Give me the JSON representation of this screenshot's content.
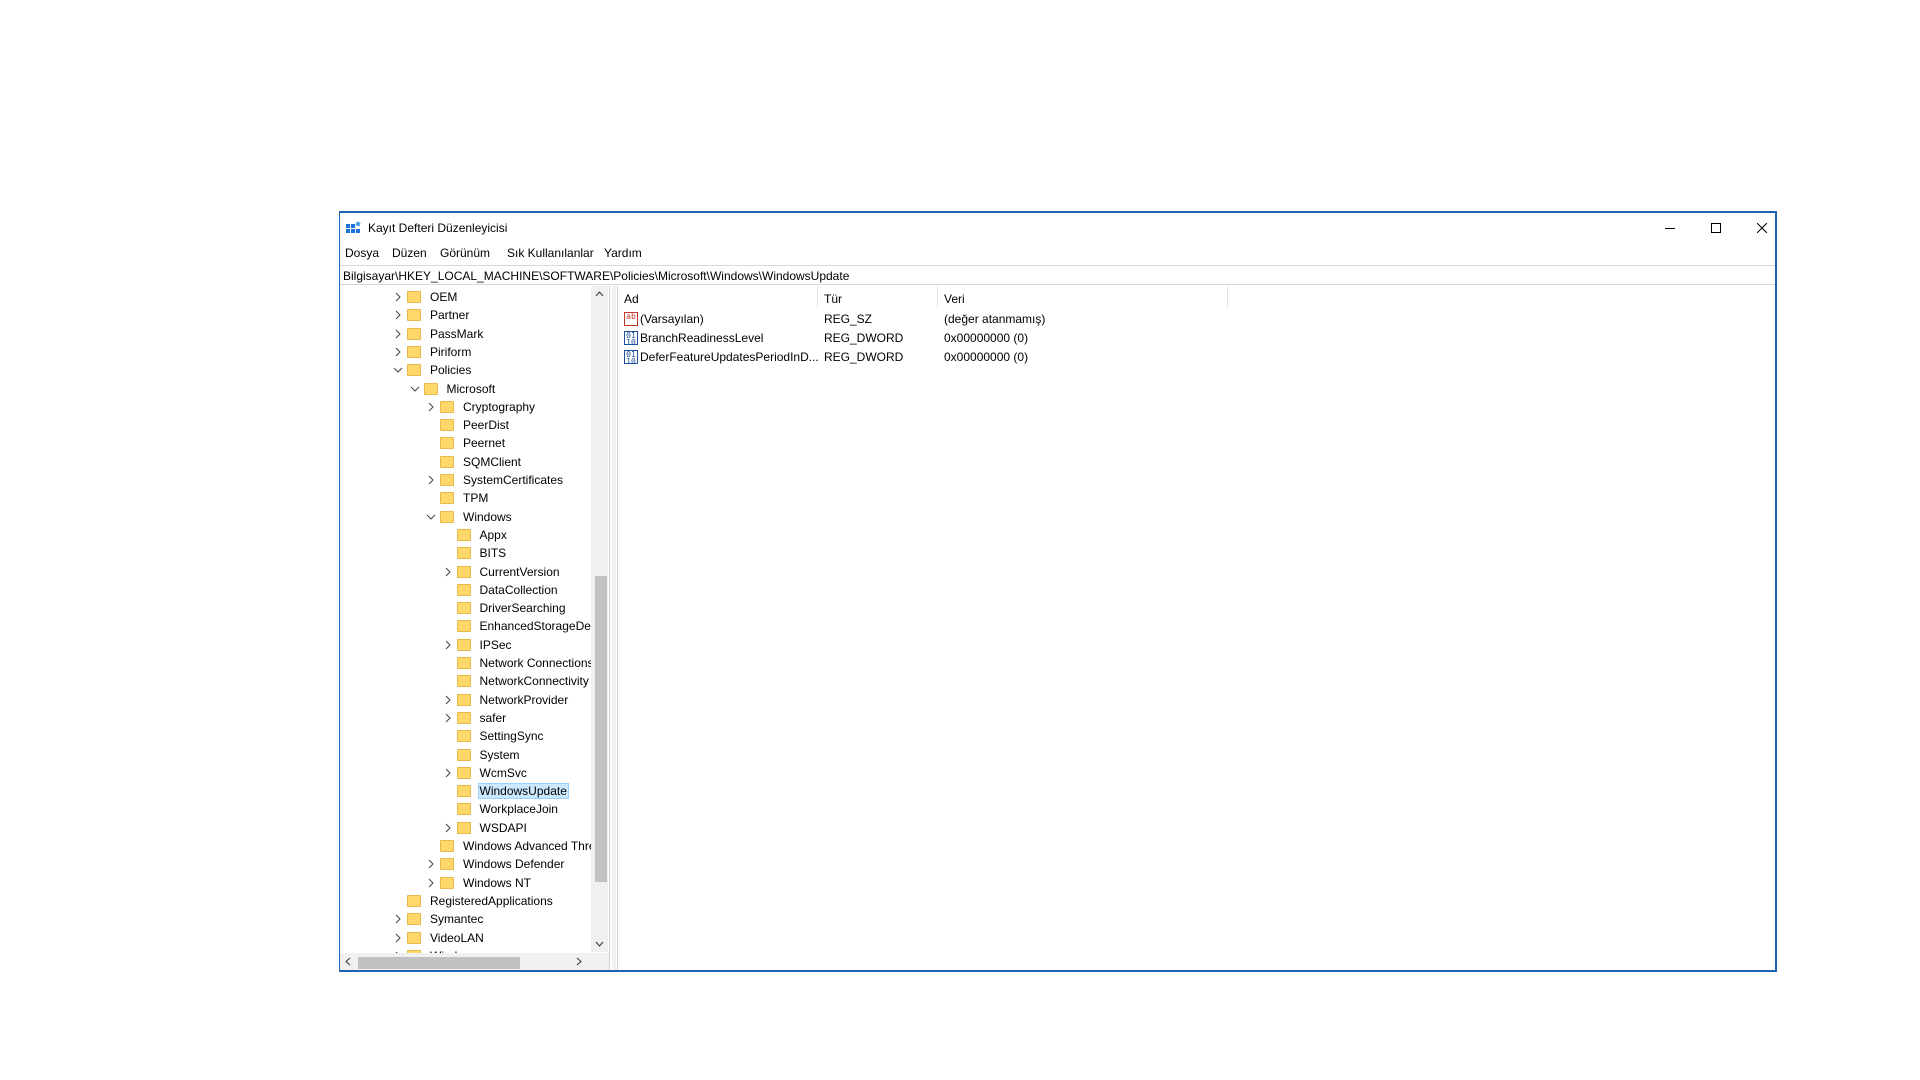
{
  "window": {
    "title": "Kayıt Defteri Düzenleyicisi",
    "controls": [
      "minimize",
      "maximize",
      "close"
    ]
  },
  "menu": [
    "Dosya",
    "Düzen",
    "Görünüm",
    "Sık Kullanılanlar",
    "Yardım"
  ],
  "address": "Bilgisayar\\HKEY_LOCAL_MACHINE\\SOFTWARE\\Policies\\Microsoft\\Windows\\WindowsUpdate",
  "tree": [
    {
      "label": "OEM",
      "depth": 0,
      "expander": "collapsed"
    },
    {
      "label": "Partner",
      "depth": 0,
      "expander": "collapsed"
    },
    {
      "label": "PassMark",
      "depth": 0,
      "expander": "collapsed"
    },
    {
      "label": "Piriform",
      "depth": 0,
      "expander": "collapsed"
    },
    {
      "label": "Policies",
      "depth": 0,
      "expander": "expanded"
    },
    {
      "label": "Microsoft",
      "depth": 1,
      "expander": "expanded"
    },
    {
      "label": "Cryptography",
      "depth": 2,
      "expander": "collapsed"
    },
    {
      "label": "PeerDist",
      "depth": 2,
      "expander": "none"
    },
    {
      "label": "Peernet",
      "depth": 2,
      "expander": "none"
    },
    {
      "label": "SQMClient",
      "depth": 2,
      "expander": "none"
    },
    {
      "label": "SystemCertificates",
      "depth": 2,
      "expander": "collapsed"
    },
    {
      "label": "TPM",
      "depth": 2,
      "expander": "none"
    },
    {
      "label": "Windows",
      "depth": 2,
      "expander": "expanded"
    },
    {
      "label": "Appx",
      "depth": 3,
      "expander": "none"
    },
    {
      "label": "BITS",
      "depth": 3,
      "expander": "none"
    },
    {
      "label": "CurrentVersion",
      "depth": 3,
      "expander": "collapsed"
    },
    {
      "label": "DataCollection",
      "depth": 3,
      "expander": "none"
    },
    {
      "label": "DriverSearching",
      "depth": 3,
      "expander": "none"
    },
    {
      "label": "EnhancedStorageDev",
      "depth": 3,
      "expander": "none"
    },
    {
      "label": "IPSec",
      "depth": 3,
      "expander": "collapsed"
    },
    {
      "label": "Network Connections",
      "depth": 3,
      "expander": "none"
    },
    {
      "label": "NetworkConnectivity",
      "depth": 3,
      "expander": "none"
    },
    {
      "label": "NetworkProvider",
      "depth": 3,
      "expander": "collapsed"
    },
    {
      "label": "safer",
      "depth": 3,
      "expander": "collapsed"
    },
    {
      "label": "SettingSync",
      "depth": 3,
      "expander": "none"
    },
    {
      "label": "System",
      "depth": 3,
      "expander": "none"
    },
    {
      "label": "WcmSvc",
      "depth": 3,
      "expander": "collapsed"
    },
    {
      "label": "WindowsUpdate",
      "depth": 3,
      "expander": "none",
      "selected": true
    },
    {
      "label": "WorkplaceJoin",
      "depth": 3,
      "expander": "none"
    },
    {
      "label": "WSDAPI",
      "depth": 3,
      "expander": "collapsed"
    },
    {
      "label": "Windows Advanced Threat",
      "depth": 2,
      "expander": "none"
    },
    {
      "label": "Windows Defender",
      "depth": 2,
      "expander": "collapsed"
    },
    {
      "label": "Windows NT",
      "depth": 2,
      "expander": "collapsed"
    },
    {
      "label": "RegisteredApplications",
      "depth": 0,
      "expander": "none"
    },
    {
      "label": "Symantec",
      "depth": 0,
      "expander": "collapsed"
    },
    {
      "label": "VideoLAN",
      "depth": 0,
      "expander": "collapsed"
    },
    {
      "label": "Windows",
      "depth": 0,
      "expander": "collapsed"
    }
  ],
  "columns": {
    "name": "Ad",
    "type": "Tür",
    "data": "Veri"
  },
  "values": [
    {
      "name": "(Varsayılan)",
      "type": "REG_SZ",
      "data": "(değer atanmamış)",
      "icon": "string-value-icon"
    },
    {
      "name": "BranchReadinessLevel",
      "type": "REG_DWORD",
      "data": "0x00000000 (0)",
      "icon": "binary-value-icon"
    },
    {
      "name": "DeferFeatureUpdatesPeriodInD...",
      "type": "REG_DWORD",
      "data": "0x00000000 (0)",
      "icon": "binary-value-icon"
    }
  ],
  "colors": {
    "accent": "#1e63b4",
    "folder": "#ffd86b",
    "selection": "#cce8ff"
  }
}
